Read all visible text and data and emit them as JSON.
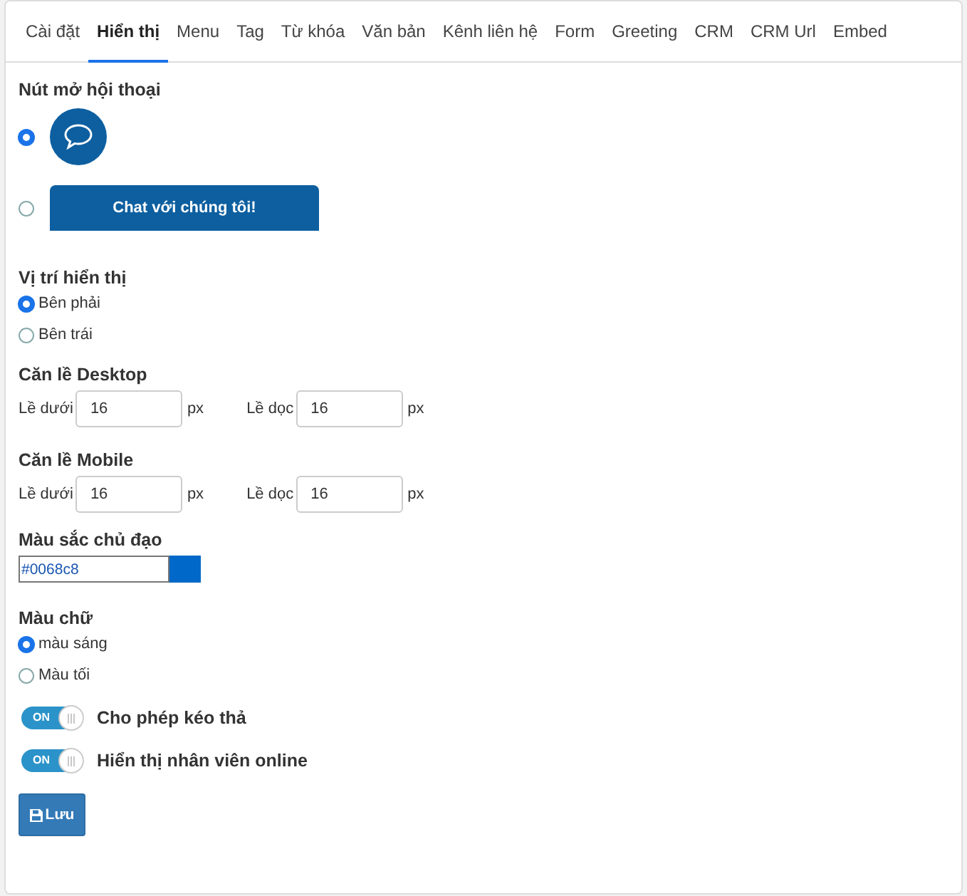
{
  "tabs": [
    {
      "label": "Cài đặt",
      "selected": false
    },
    {
      "label": "Hiển thị",
      "selected": true
    },
    {
      "label": "Menu",
      "selected": false
    },
    {
      "label": "Tag",
      "selected": false
    },
    {
      "label": "Từ khóa",
      "selected": false
    },
    {
      "label": "Văn bản",
      "selected": false
    },
    {
      "label": "Kênh liên hệ",
      "selected": false
    },
    {
      "label": "Form",
      "selected": false
    },
    {
      "label": "Greeting",
      "selected": false
    },
    {
      "label": "CRM",
      "selected": false
    },
    {
      "label": "CRM Url",
      "selected": false
    },
    {
      "label": "Embed",
      "selected": false
    }
  ],
  "chat_button": {
    "title": "Nút mở hội thoại",
    "options": [
      {
        "kind": "icon",
        "selected": true
      },
      {
        "kind": "text",
        "label": "Chat với chúng tôi!",
        "selected": false
      }
    ]
  },
  "position": {
    "title": "Vị trí hiển thị",
    "options": [
      {
        "label": "Bên phải",
        "selected": true
      },
      {
        "label": "Bên trái",
        "selected": false
      }
    ]
  },
  "margins": [
    {
      "title": "Căn lề Desktop",
      "fields": [
        {
          "label": "Lề dưới",
          "value": "16",
          "unit": "px"
        },
        {
          "label": "Lề dọc",
          "value": "16",
          "unit": "px"
        }
      ]
    },
    {
      "title": "Căn lề Mobile",
      "fields": [
        {
          "label": "Lề dưới",
          "value": "16",
          "unit": "px"
        },
        {
          "label": "Lề dọc",
          "value": "16",
          "unit": "px"
        }
      ]
    }
  ],
  "main_color": {
    "title": "Màu sắc chủ đạo",
    "value": "#0068c8",
    "color": "#0068c8"
  },
  "text_color": {
    "title": "Màu chữ",
    "options": [
      {
        "label": "màu sáng",
        "selected": true
      },
      {
        "label": "Màu tối",
        "selected": false
      }
    ]
  },
  "toggles": [
    {
      "label": "Cho phép kéo thả",
      "on": true,
      "on_text": "ON"
    },
    {
      "label": "Hiển thị nhân viên online",
      "on": true,
      "on_text": "ON"
    }
  ],
  "save_button": {
    "label": "Lưu"
  }
}
